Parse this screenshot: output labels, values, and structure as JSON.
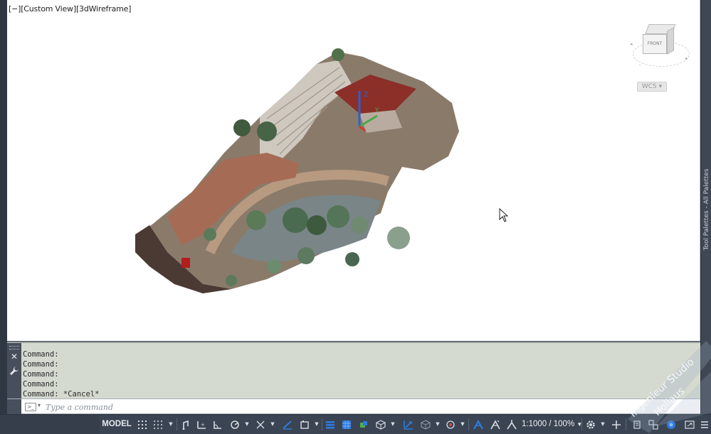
{
  "viewport": {
    "controls": {
      "minimize": "[−]",
      "view": "[Custom View]",
      "visual_style": "[3dWireframe]"
    },
    "viewcube": {
      "face_label": "FRONT",
      "wcs_label": "WCS"
    }
  },
  "tool_palettes": {
    "label": "Tool Palettes - All Palettes"
  },
  "command_line": {
    "history": [
      "Command:",
      "Command:",
      "Command:",
      "Command:",
      "Command: *Cancel*"
    ],
    "input_placeholder": "Type a command"
  },
  "statusbar": {
    "model_label": "MODEL",
    "scale_label": "1:1000 / 100%",
    "icons": [
      "grid-icon",
      "snap-icon",
      "infer-icon",
      "ortho-icon",
      "polar-icon",
      "isodraft-icon",
      "osnap-icon",
      "2d-osnap-icon",
      "lineweight-icon",
      "transparency-icon",
      "selection-cycling-icon",
      "3d-osnap-icon",
      "dynamic-ucs-icon",
      "selection-filter-icon",
      "gizmo-icon",
      "annotation-visibility-icon",
      "auto-scale-icon",
      "annotation-scale-icon",
      "workspace-icon",
      "annotation-monitor-icon",
      "units-icon",
      "quick-properties-icon",
      "lock-ui-icon",
      "isolate-objects-icon",
      "hardware-acceleration-icon",
      "clean-screen-icon",
      "customization-icon"
    ]
  },
  "watermark": {
    "line1": "Ingenieur Studio",
    "line2": "Hollaus"
  },
  "colors": {
    "viewport_bg": "#ffffff",
    "command_bg": "#d4dad0",
    "statusbar_bg": "#3b4453",
    "active_icon_blue": "#2d7be0"
  }
}
